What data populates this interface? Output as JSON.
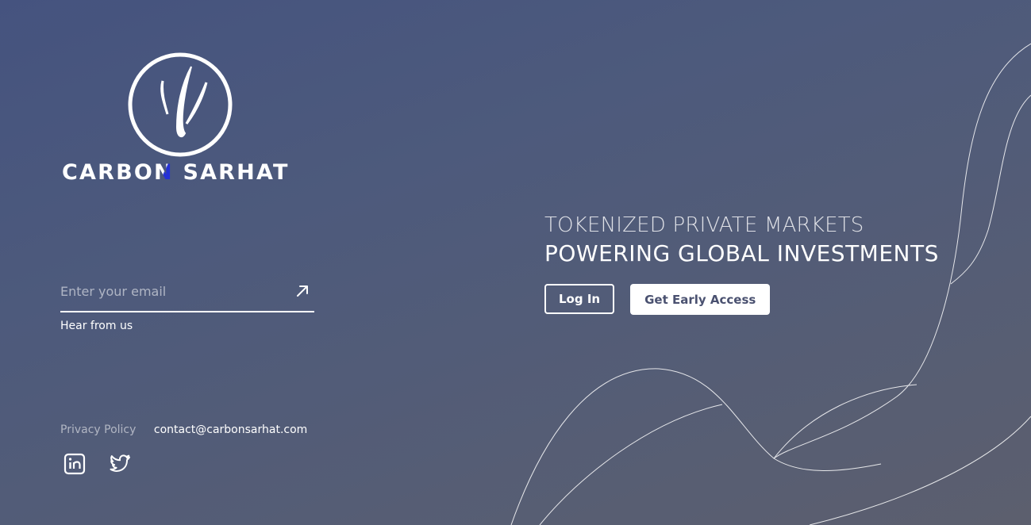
{
  "brand": {
    "name_part1": "CARBO",
    "name_accent": "N",
    "name_part2": " SARHAT",
    "logo_icon": "carbon-sarhat-emblem",
    "accent_color": "#2431d6"
  },
  "subscribe": {
    "email_placeholder": "Enter your email",
    "email_value": "",
    "submit_icon": "arrow-up-right-icon",
    "caption": "Hear from us"
  },
  "footer": {
    "privacy_label": "Privacy Policy",
    "contact_email": "contact@carbonsarhat.com",
    "social": [
      {
        "icon": "linkedin-icon"
      },
      {
        "icon": "twitter-icon"
      }
    ]
  },
  "hero": {
    "tagline_line1": "TOKENIZED PRIVATE MARKETS",
    "tagline_line2": "POWERING GLOBAL INVESTMENTS"
  },
  "actions": {
    "login_label": "Log In",
    "early_access_label": "Get Early Access"
  },
  "theme": {
    "background_start": "#45537f",
    "background_end": "#5c5f6e",
    "solid_button_text": "#4a5170"
  }
}
